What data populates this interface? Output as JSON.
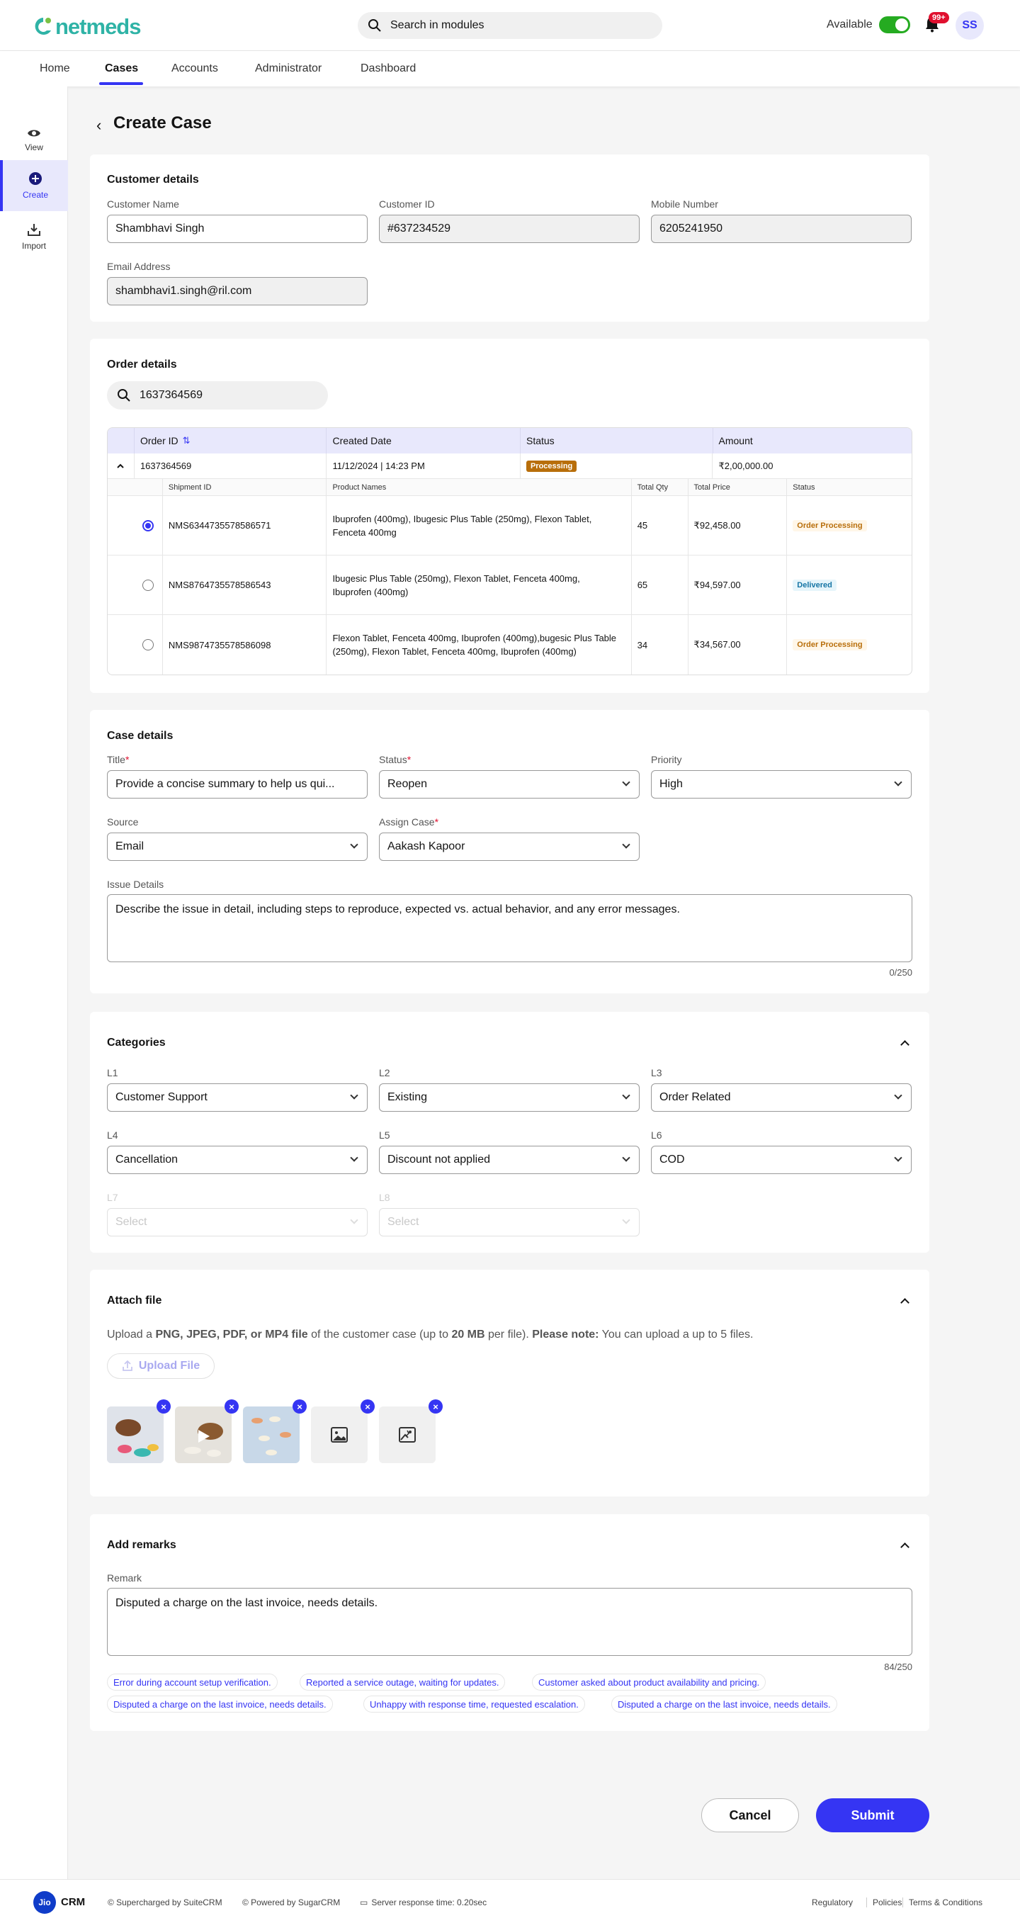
{
  "header": {
    "logo_text": "netmeds",
    "search_placeholder": "Search in modules",
    "availability_label": "Available",
    "notification_count": "99+",
    "avatar_initials": "SS"
  },
  "nav": {
    "tabs": [
      "Home",
      "Cases",
      "Accounts",
      "Administrator",
      "Dashboard"
    ],
    "active": "Cases"
  },
  "sidebar": {
    "items": [
      "View",
      "Create",
      "Import"
    ],
    "active": "Create"
  },
  "page": {
    "title": "Create Case"
  },
  "customer": {
    "section_title": "Customer details",
    "name_label": "Customer Name",
    "name_value": "Shambhavi Singh",
    "id_label": "Customer ID",
    "id_value": "#637234529",
    "mobile_label": "Mobile Number",
    "mobile_value": "6205241950",
    "email_label": "Email Address",
    "email_value": "shambhavi1.singh@ril.com"
  },
  "order": {
    "section_title": "Order details",
    "search_value": "1637364569",
    "headers": [
      "Order ID",
      "Created Date",
      "Status",
      "Amount"
    ],
    "row": {
      "id": "1637364569",
      "date": "11/12/2024 | 14:23 PM",
      "status": "Processing",
      "amount": "₹2,00,000.00"
    },
    "sub_headers": [
      "Shipment ID",
      "Product Names",
      "Total Qty",
      "Total Price",
      "Status"
    ],
    "shipments": [
      {
        "id": "NMS6344735578586571",
        "products": "Ibuprofen (400mg), Ibugesic Plus Table (250mg), Flexon Tablet, Fenceta 400mg",
        "qty": "45",
        "price": "₹92,458.00",
        "status": "Order Processing"
      },
      {
        "id": "NMS8764735578586543",
        "products": "Ibugesic Plus Table (250mg), Flexon Tablet, Fenceta 400mg, Ibuprofen (400mg)",
        "qty": "65",
        "price": "₹94,597.00",
        "status": "Delivered"
      },
      {
        "id": "NMS9874735578586098",
        "products": "Flexon Tablet, Fenceta 400mg, Ibuprofen (400mg),bugesic Plus Table (250mg), Flexon Tablet, Fenceta 400mg, Ibuprofen (400mg)",
        "qty": "34",
        "price": "₹34,567.00",
        "status": "Order Processing"
      }
    ]
  },
  "case": {
    "section_title": "Case details",
    "title_label": "Title",
    "title_value": "Provide a concise summary to help us qui...",
    "status_label": "Status",
    "status_value": "Reopen",
    "priority_label": "Priority",
    "priority_value": "High",
    "source_label": "Source",
    "source_value": "Email",
    "assign_label": "Assign Case",
    "assign_value": "Aakash Kapoor",
    "issue_label": "Issue Details",
    "issue_placeholder": "Describe the issue in detail, including steps to reproduce, expected vs. actual behavior, and any error messages.",
    "issue_counter": "0/250"
  },
  "categories": {
    "section_title": "Categories",
    "fields": [
      {
        "label": "L1",
        "value": "Customer Support"
      },
      {
        "label": "L2",
        "value": "Existing"
      },
      {
        "label": "L3",
        "value": "Order Related"
      },
      {
        "label": "L4",
        "value": "Cancellation"
      },
      {
        "label": "L5",
        "value": "Discount not applied"
      },
      {
        "label": "L6",
        "value": "COD"
      },
      {
        "label": "L7",
        "value": "Select"
      },
      {
        "label": "L8",
        "value": "Select"
      }
    ]
  },
  "attach": {
    "section_title": "Attach file",
    "desc_1": "Upload a ",
    "desc_2": "PNG, JPEG, PDF, or MP4 file",
    "desc_3": " of the customer case (up to ",
    "desc_4": "20 MB",
    "desc_5": " per file). ",
    "desc_6": "Please note:",
    "desc_7": " You can upload a up to 5 files.",
    "upload_label": "Upload File"
  },
  "remarks": {
    "section_title": "Add remarks",
    "remark_label": "Remark",
    "remark_value": "Disputed a charge on the last invoice, needs details.",
    "counter": "84/250",
    "suggestions": [
      "Error during account setup verification.",
      "Reported a service outage, waiting for updates.",
      "Customer asked about product availability and pricing.",
      "Disputed a charge on the last invoice, needs details.",
      "Unhappy with response time, requested escalation.",
      "Disputed a charge on the last invoice, needs details."
    ]
  },
  "actions": {
    "cancel": "Cancel",
    "submit": "Submit"
  },
  "footer": {
    "brand": "CRM",
    "jio": "Jio",
    "supercharged": "© Supercharged by SuiteCRM",
    "powered": "© Powered by SugarCRM",
    "server": "Server response time: 0.20sec",
    "links": [
      "Regulatory",
      "Policies",
      "Terms & Conditions"
    ]
  },
  "colors": {
    "primary": "#3535f3",
    "toggle_on": "#25ab21",
    "processing": "#b86e0a",
    "delivered": "#1675a5",
    "brand_teal": "#2fb3a6"
  }
}
